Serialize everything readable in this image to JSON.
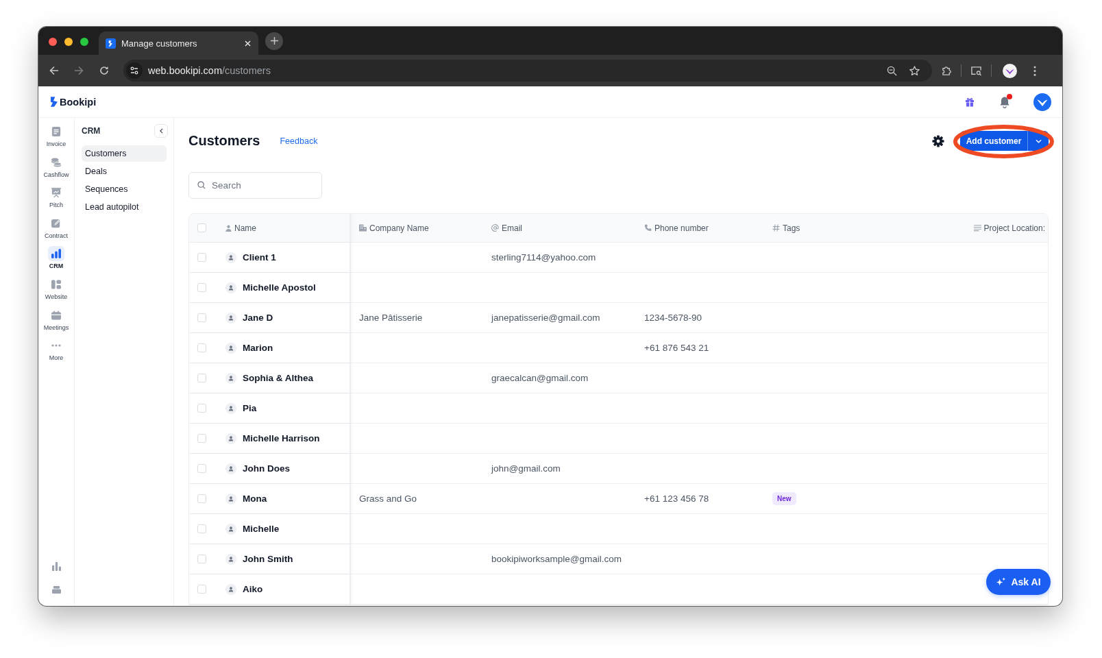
{
  "browser": {
    "tab_title": "Manage customers",
    "url_host": "web.bookipi.com",
    "url_path": "/customers"
  },
  "app": {
    "logo": "Bookipi",
    "notifications_unread": true
  },
  "rail": {
    "items": [
      {
        "label": "Invoice",
        "selected": false
      },
      {
        "label": "Cashflow",
        "selected": false
      },
      {
        "label": "Pitch",
        "selected": false
      },
      {
        "label": "Contract",
        "selected": false
      },
      {
        "label": "CRM",
        "selected": true
      },
      {
        "label": "Website",
        "selected": false
      },
      {
        "label": "Meetings",
        "selected": false
      },
      {
        "label": "More",
        "selected": false
      }
    ]
  },
  "crm_menu": {
    "title": "CRM",
    "items": [
      {
        "label": "Customers",
        "selected": true
      },
      {
        "label": "Deals",
        "selected": false
      },
      {
        "label": "Sequences",
        "selected": false
      },
      {
        "label": "Lead autopilot",
        "selected": false
      }
    ]
  },
  "page": {
    "title": "Customers",
    "feedback": "Feedback",
    "add_button": {
      "label": "Add customer",
      "circled": true
    }
  },
  "search": {
    "placeholder": "Search"
  },
  "table": {
    "select_all": {
      "checked": false
    },
    "columns": [
      {
        "label": "Name"
      },
      {
        "label": "Company Name"
      },
      {
        "label": "Email"
      },
      {
        "label": "Phone number"
      },
      {
        "label": "Tags"
      },
      {
        "label": "Project Location:"
      }
    ],
    "rows": [
      {
        "name": "Client 1",
        "email": "sterling7114@yahoo.com",
        "checked": false
      },
      {
        "name": "Michelle Apostol",
        "checked": false
      },
      {
        "name": "Jane D",
        "company_name": "Jane Pâtisserie",
        "email": "janepatisserie@gmail.com",
        "phone_number": "1234-5678-90",
        "checked": false
      },
      {
        "name": "Marion",
        "phone_number": "+61 876 543 21",
        "checked": false
      },
      {
        "name": "Sophia & Althea",
        "email": "graecalcan@gmail.com",
        "checked": false
      },
      {
        "name": "Pia",
        "checked": false
      },
      {
        "name": "Michelle Harrison",
        "checked": false
      },
      {
        "name": "John Does",
        "email": "john@gmail.com",
        "checked": false
      },
      {
        "name": "Mona",
        "company_name": "Grass and Go",
        "phone_number": "+61 123 456 78",
        "tags": [
          "New"
        ],
        "checked": false
      },
      {
        "name": "Michelle",
        "checked": false
      },
      {
        "name": "John Smith",
        "email": "bookipiworksample@gmail.com",
        "checked": false
      },
      {
        "name": "Aiko",
        "checked": false
      }
    ]
  },
  "ask_ai": {
    "label": "Ask AI"
  }
}
